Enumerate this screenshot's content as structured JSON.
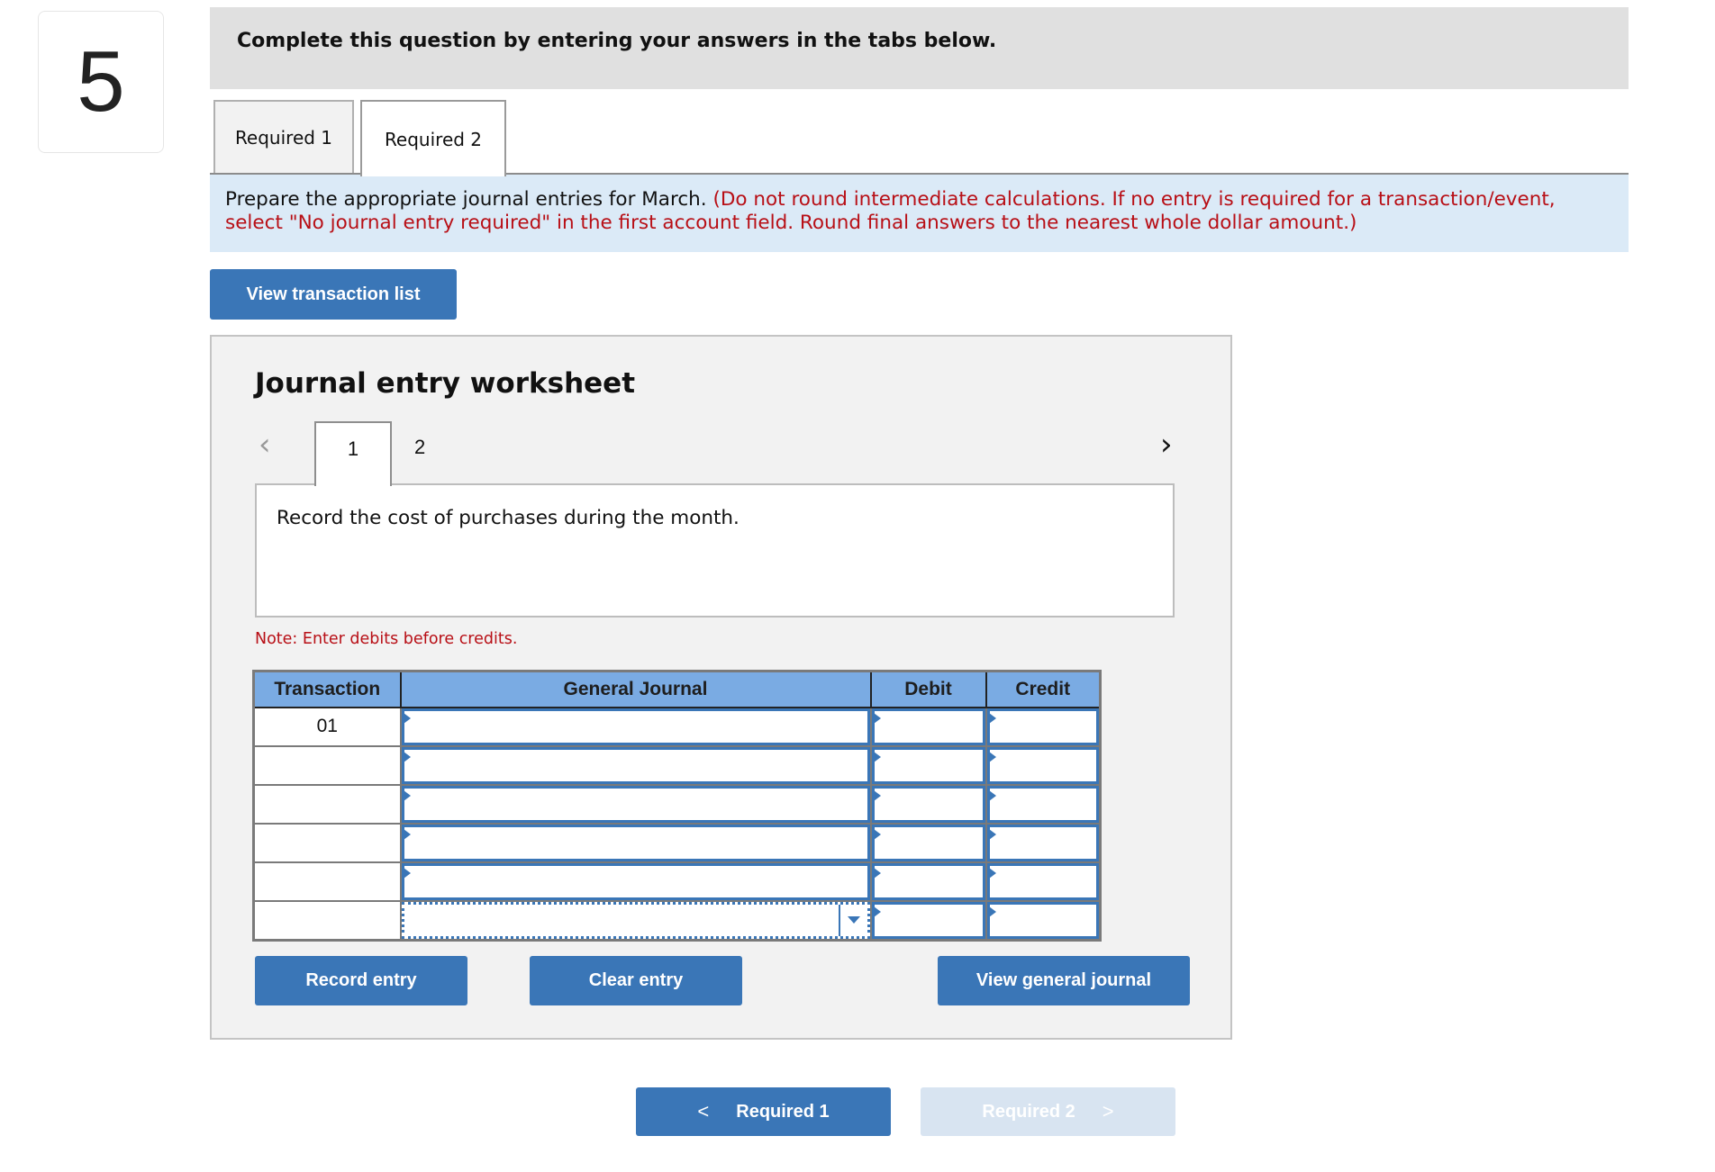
{
  "question": {
    "number": "5"
  },
  "header": {
    "title": "Complete this question by entering your answers in the tabs below."
  },
  "tabs": [
    {
      "label": "Required 1",
      "active": false
    },
    {
      "label": "Required 2",
      "active": true
    }
  ],
  "instructions": {
    "main": "Prepare the appropriate journal entries for March.",
    "note": "(Do not round intermediate calculations. If no entry is required for a transaction/event, select \"No journal entry required\" in the first account field. Round final answers to the nearest whole dollar amount.)"
  },
  "view_transaction_list_label": "View transaction list",
  "worksheet": {
    "title": "Journal entry worksheet",
    "prev_icon": "chevron-left-icon",
    "next_icon": "chevron-right-icon",
    "pages": [
      "1",
      "2"
    ],
    "active_page": "1",
    "description": "Record the cost of purchases during the month.",
    "note": "Note: Enter debits before credits.",
    "table": {
      "columns": [
        "Transaction",
        "General Journal",
        "Debit",
        "Credit"
      ],
      "rows": [
        {
          "transaction": "01",
          "account": "",
          "debit": "",
          "credit": ""
        },
        {
          "transaction": "",
          "account": "",
          "debit": "",
          "credit": ""
        },
        {
          "transaction": "",
          "account": "",
          "debit": "",
          "credit": ""
        },
        {
          "transaction": "",
          "account": "",
          "debit": "",
          "credit": ""
        },
        {
          "transaction": "",
          "account": "",
          "debit": "",
          "credit": ""
        },
        {
          "transaction": "",
          "account": "",
          "debit": "",
          "credit": ""
        }
      ]
    },
    "buttons": {
      "record": "Record entry",
      "clear": "Clear entry",
      "view_general_journal": "View general journal"
    }
  },
  "navigation": {
    "prev_label": "Required 1",
    "next_label": "Required 2",
    "prev_icon": "<",
    "next_icon": ">"
  },
  "colors": {
    "button_blue": "#3a76b7",
    "header_blue": "#7aabe3",
    "instruction_bg": "#dbeaf7",
    "warning_red": "#b80f16",
    "disabled_button": "#d8e4f1"
  }
}
